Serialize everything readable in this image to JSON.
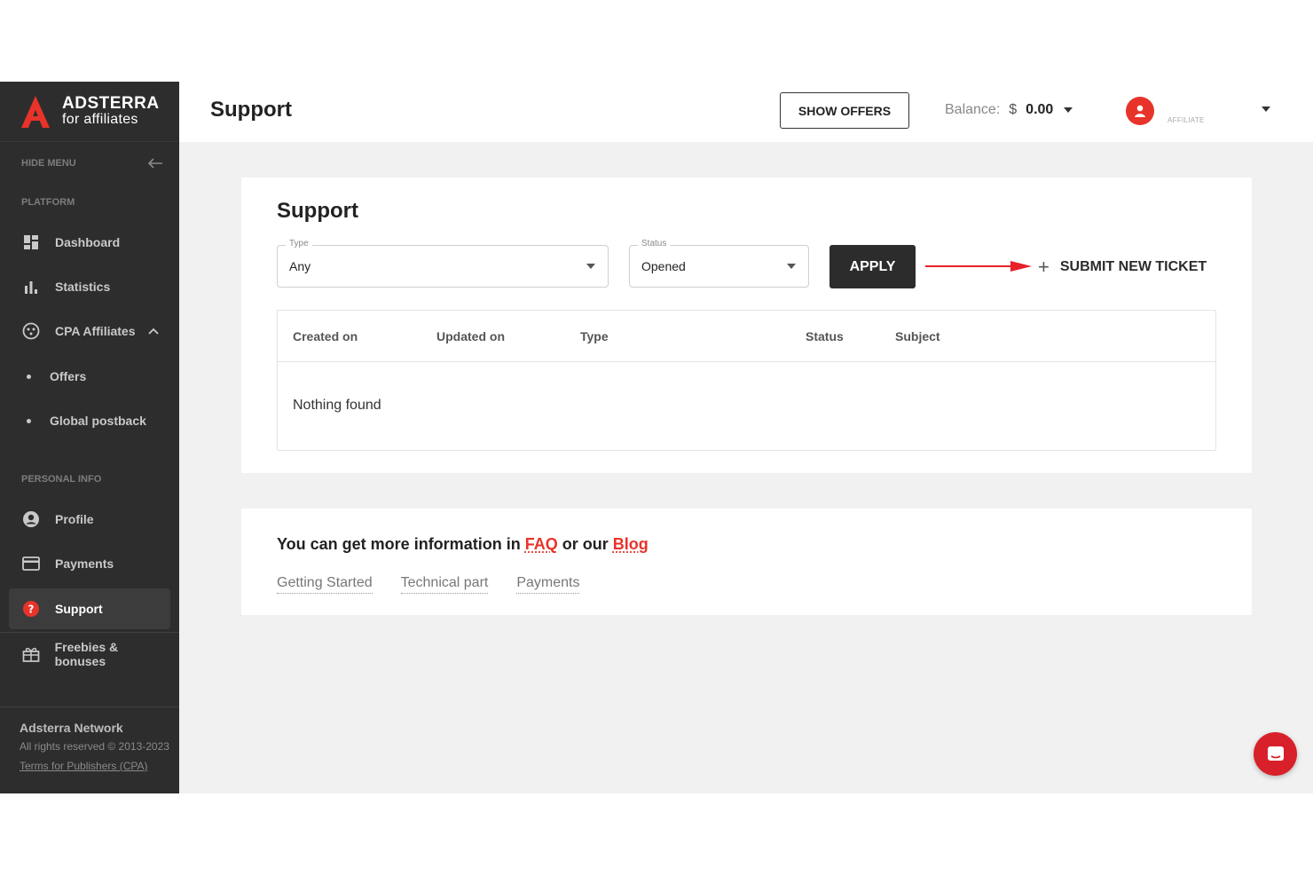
{
  "brand": {
    "title": "ADSTERRA",
    "subtitle": "for affiliates",
    "accent": "#e8332a"
  },
  "sidebar": {
    "hide_menu": "HIDE MENU",
    "platform_label": "PLATFORM",
    "personal_label": "PERSONAL INFO",
    "items": [
      {
        "label": "Dashboard",
        "icon": "dashboard-icon"
      },
      {
        "label": "Statistics",
        "icon": "bar-chart-icon"
      },
      {
        "label": "CPA Affiliates",
        "icon": "cpa-icon"
      },
      {
        "label": "Offers"
      },
      {
        "label": "Global postback"
      },
      {
        "label": "Profile",
        "icon": "profile-icon"
      },
      {
        "label": "Payments",
        "icon": "card-icon"
      },
      {
        "label": "Support",
        "icon": "support-icon",
        "active": true
      },
      {
        "label": "Freebies & bonuses",
        "icon": "gift-icon"
      }
    ],
    "footer": {
      "network": "Adsterra Network",
      "rights": "All rights reserved © 2013-2023",
      "terms": "Terms for Publishers (CPA)"
    }
  },
  "header": {
    "title": "Support",
    "show_offers": "SHOW OFFERS",
    "balance_label": "Balance:",
    "currency": "$",
    "balance_amount": "0.00",
    "role": "AFFILIATE"
  },
  "support": {
    "title": "Support",
    "type_filter": {
      "label": "Type",
      "value": "Any"
    },
    "status_filter": {
      "label": "Status",
      "value": "Opened"
    },
    "apply": "APPLY",
    "submit_ticket": "SUBMIT NEW TICKET",
    "columns": [
      "Created on",
      "Updated on",
      "Type",
      "Status",
      "Subject"
    ],
    "empty_text": "Nothing found"
  },
  "info": {
    "text_before": "You can get more information in",
    "faq": "FAQ",
    "text_mid": "or our",
    "blog": "Blog",
    "links": [
      "Getting Started",
      "Technical part",
      "Payments"
    ]
  }
}
